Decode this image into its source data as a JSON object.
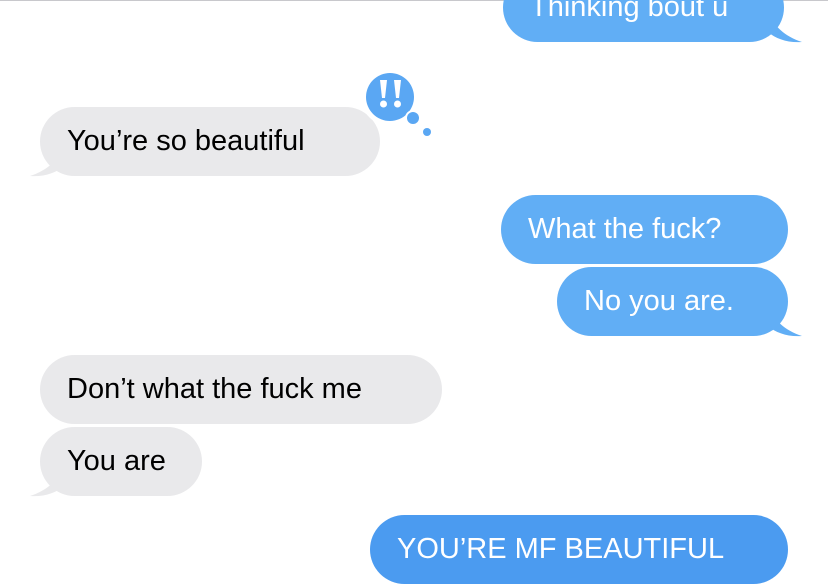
{
  "colors": {
    "sent_bubble": "#61aef5",
    "sent_bubble_last": "#4b9bf0",
    "received_bubble": "#e9e9eb",
    "tapback_bg": "#5aa7f3",
    "tapback_glyph": "#ffffff"
  },
  "messages": [
    {
      "side": "sent",
      "text": "Thinking bout u",
      "tail": true
    },
    {
      "side": "received",
      "text": "You’re so beautiful",
      "tail": true,
      "reaction": "!!",
      "reaction_icon": "double-exclamation-icon"
    },
    {
      "side": "sent",
      "text": "What the fuck?",
      "tail": false
    },
    {
      "side": "sent",
      "text": "No you are.",
      "tail": true
    },
    {
      "side": "received",
      "text": "Don’t what the fuck me",
      "tail": false
    },
    {
      "side": "received",
      "text": "You are",
      "tail": true
    },
    {
      "side": "sent",
      "text": "YOU’RE MF BEAUTIFUL",
      "tail": false
    }
  ]
}
